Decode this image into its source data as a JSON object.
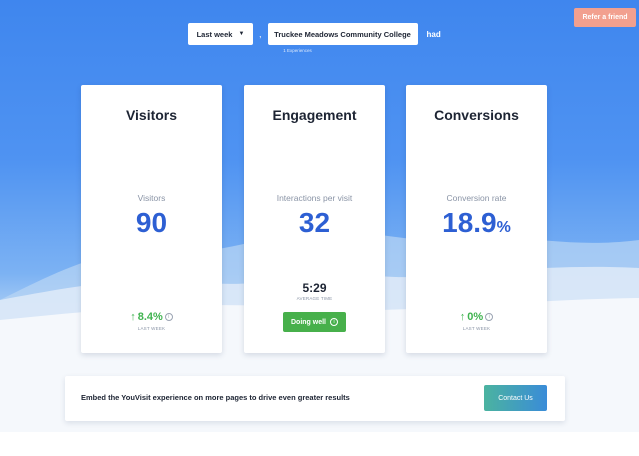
{
  "header": {
    "refer_label": "Refer a friend",
    "period_select": "Last week",
    "comma": ",",
    "college_name": "Truckee Meadows Community College",
    "had": "had",
    "experiences_count": "1 Experiences"
  },
  "cards": {
    "visitors": {
      "title": "Visitors",
      "label": "Visitors",
      "value": "90",
      "change": "8.4%",
      "period": "LAST WEEK"
    },
    "engagement": {
      "title": "Engagement",
      "label": "Interactions per visit",
      "value": "32",
      "avg_time": "5:29",
      "avg_label": "AVERAGE TIME",
      "status": "Doing well"
    },
    "conversions": {
      "title": "Conversions",
      "label": "Conversion rate",
      "value": "18.9",
      "unit": "%",
      "change": "0%",
      "period": "LAST WEEK"
    }
  },
  "embed": {
    "text": "Embed the YouVisit experience on more pages to drive even greater results",
    "button": "Contact Us"
  },
  "icons": {
    "up_arrow": "↑",
    "info": "i",
    "caret": "▼"
  },
  "colors": {
    "primary_blue": "#2d5fd3",
    "positive_green": "#3fb34f",
    "status_green": "#47b04b",
    "refer_salmon": "#f2a08f"
  }
}
